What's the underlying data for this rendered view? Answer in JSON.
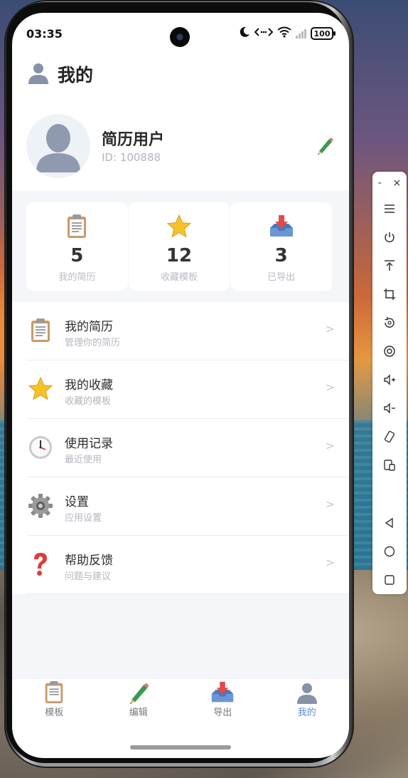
{
  "status_bar": {
    "time": "03:35",
    "battery": "100",
    "icons": [
      "moon-icon",
      "data-transfer-icon",
      "wifi-icon",
      "signal-icon",
      "battery-icon"
    ]
  },
  "header": {
    "title": "我的",
    "icon": "user-icon"
  },
  "profile": {
    "name": "简历用户",
    "id_text": "ID: 100888",
    "edit_icon": "pencil-icon"
  },
  "stats": [
    {
      "value": "5",
      "label": "我的简历",
      "icon": "clipboard-icon"
    },
    {
      "value": "12",
      "label": "收藏模板",
      "icon": "star-icon"
    },
    {
      "value": "3",
      "label": "已导出",
      "icon": "download-tray-icon"
    }
  ],
  "menu": [
    {
      "title": "我的简历",
      "subtitle": "管理你的简历",
      "icon": "clipboard-icon",
      "arrow": ">"
    },
    {
      "title": "我的收藏",
      "subtitle": "收藏的模板",
      "icon": "star-icon",
      "arrow": ">"
    },
    {
      "title": "使用记录",
      "subtitle": "最近使用",
      "icon": "clock-icon",
      "arrow": ">"
    },
    {
      "title": "设置",
      "subtitle": "应用设置",
      "icon": "gear-icon",
      "arrow": ">"
    },
    {
      "title": "帮助反馈",
      "subtitle": "问题与建议",
      "icon": "question-icon",
      "arrow": ">"
    }
  ],
  "tabbar": {
    "active": "我的",
    "active_color": "#5b8be0",
    "tabs": [
      {
        "label": "模板",
        "icon": "clipboard-icon"
      },
      {
        "label": "编辑",
        "icon": "pencil-icon"
      },
      {
        "label": "导出",
        "icon": "download-tray-icon"
      },
      {
        "label": "我的",
        "icon": "user-icon"
      }
    ]
  },
  "side_toolbar": {
    "minimize": "-",
    "close": "×",
    "buttons": [
      "menu-icon",
      "power-icon",
      "pin-top-icon",
      "crop-icon",
      "rotate-icon",
      "screenshot-icon",
      "volume-up-icon",
      "volume-down-icon",
      "rotate-device-icon",
      "multi-screen-icon",
      "back-icon",
      "home-icon",
      "recents-icon"
    ]
  },
  "colors": {
    "page_bg": "#f4f6fa",
    "accent": "#5b8be0",
    "title_text": "#222222",
    "subtext": "#b3b7be"
  }
}
